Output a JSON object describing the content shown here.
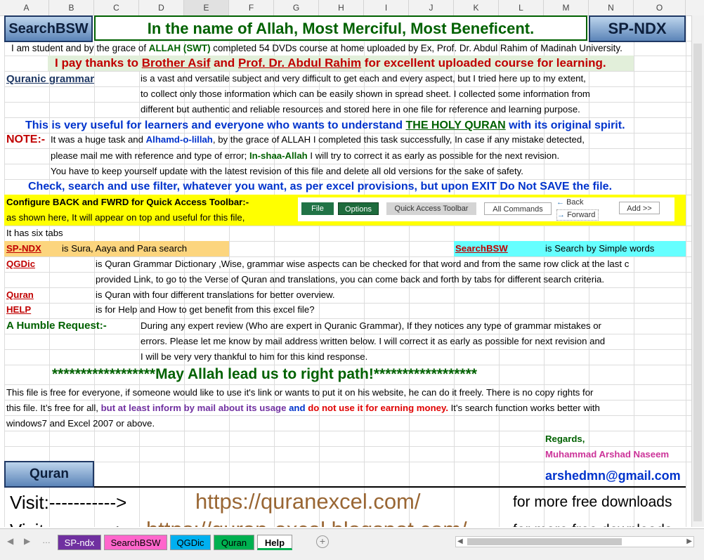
{
  "columns": [
    "A",
    "B",
    "C",
    "D",
    "E",
    "F",
    "G",
    "H",
    "I",
    "J",
    "K",
    "L",
    "M",
    "N",
    "O"
  ],
  "header": {
    "left_button": "SearchBSW",
    "title": "In the name of Allah, Most Merciful, Most Beneficent.",
    "right_button": "SP-NDX"
  },
  "intro": {
    "a": "I am student and by the grace of ",
    "b": "ALLAH (SWT)",
    "c": " completed 54 DVDs course at home uploaded by Ex, Prof. Dr. Abdul Rahim of Madinah University."
  },
  "thanks": {
    "a": "I pay thanks to ",
    "b": "Brother Asif",
    "c": " and ",
    "d": "Prof. Dr. Abdul Rahim",
    "e": " for excellent uploaded course for learning."
  },
  "grammar": {
    "label": "Quranic grammar",
    "line1": "is a vast and versatile subject and very difficult to get each and every aspect, but I tried here up to my extent,",
    "line2": "to collect only those information which can be easily shown in spread sheet. I collected some information from",
    "line3": "different but authentic and reliable resources and stored here in one file for reference and learning purpose."
  },
  "useful": {
    "a": "This is very useful for learners and everyone who wants to understand ",
    "b": "THE HOLY QURAN",
    "c": " with its original spirit."
  },
  "note": {
    "label": "NOTE:-",
    "l1a": "It was a huge task and ",
    "l1b": "Alhamd-o-lillah",
    "l1c": ", by the grace of ALLAH I completed this task successfully, In case if any mistake detected,",
    "l2a": "please mail me with reference and type of error; ",
    "l2b": "In-shaa-Allah",
    "l2c": " I will try to correct it as early as possible for the next revision.",
    "l3": "You have to keep yourself update with the latest revision of this file and delete all old versions for the sake of safety."
  },
  "check": "Check, search and use filter, whatever you want, as per excel provisions, but upon EXIT Do Not SAVE the file.",
  "configure": {
    "title": "Configure BACK and FWRD for Quick Access Toolbar:-",
    "line2": "as shown here, It will appear on top and useful for this file,",
    "file_btn": "File",
    "options_btn": "Options",
    "qat_btn": "Quick Access Toolbar",
    "allcmd_btn": "All Commands",
    "back": "Back",
    "forward": "Forward",
    "add_btn": "Add >>"
  },
  "six_tabs": "It has six tabs",
  "spndx": {
    "label": "SP-NDX",
    "desc": "is Sura, Aaya and Para search"
  },
  "searchbsw": {
    "label": "SearchBSW",
    "desc": "is Search by Simple words"
  },
  "qgdic": {
    "label": "QGDic",
    "line1": "is Quran Grammar Dictionary ,Wise, grammar wise aspects can be checked for that word and from the same row click at the last c",
    "line2": "provided Link, to go to the Verse of Quran and translations, you can come back and forth by tabs for different search criteria."
  },
  "quran": {
    "label": "Quran",
    "desc": "is Quran with four different translations for better overview."
  },
  "help": {
    "label": "HELP",
    "desc": "is for Help and How to get benefit from this excel file?"
  },
  "request": {
    "label": "A Humble Request:-",
    "line1": "During any expert review (Who are expert in Quranic Grammar), If they notices any type of grammar mistakes or",
    "line2": "errors. Please let me know by mail address written below. I will correct it as early as possible for next revision and",
    "line3": "I will be very very thankful to him for this kind response."
  },
  "prayer": "******************May Allah lead us to right path!******************",
  "free": {
    "line1": "This file is free for everyone, if someone would like to use it's link or wants to put it on his website, he can do it freely. There is no copy rights for",
    "l2a": "this file. It’s free for all, ",
    "l2b": "but at least inform by mail about its usage",
    "l2c": " and ",
    "l2d": "do not use it for earning money.",
    "l2e": " It's search function works better with",
    "line3": "windows7 and Excel 2007 or above."
  },
  "regards": "Regards,",
  "author": "Muhammad Arshad Naseem",
  "email": "arshedmn@gmail.com",
  "quran_button": "Quran",
  "visit1": {
    "label": "Visit:----------->",
    "url": "https://quranexcel.com/",
    "suffix": "for more free downloads"
  },
  "visit2": {
    "label": "Visit:----------->",
    "url": "https://quran-excel.blogspot.com/",
    "suffix": "for more free downloads"
  },
  "tabs": [
    {
      "label": "SP-ndx",
      "color": "#7030a0"
    },
    {
      "label": "SearchBSW",
      "color": "#ff66cc"
    },
    {
      "label": "QGDic",
      "color": "#00b0f0"
    },
    {
      "label": "Quran",
      "color": "#00b050"
    },
    {
      "label": "Help",
      "color": "#ffffff"
    }
  ],
  "colors": {
    "green": "#006100",
    "blue": "#0033cc",
    "darkred": "#c00000",
    "navy": "#1f3864",
    "purple": "#7030a0",
    "magenta": "#cc3399",
    "brown": "#996633",
    "yellow": "#ffff00",
    "orange": "#fcd57e",
    "cyan": "#66ffff"
  }
}
